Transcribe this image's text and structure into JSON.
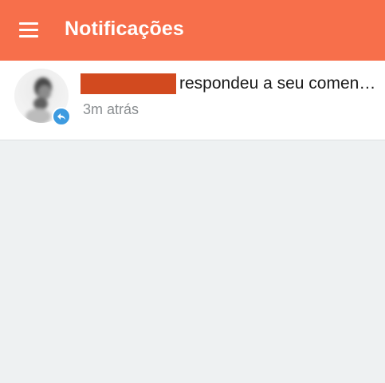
{
  "appbar": {
    "menu_icon": "hamburger-menu-icon",
    "title": "Notificações",
    "color": "#f76f4b"
  },
  "notifications": [
    {
      "sender": "",
      "message": "respondeu a seu comen…",
      "time": "3m atrás",
      "badge_icon": "reply-icon",
      "badge_color": "#3d9be0",
      "redaction_color": "#d24a1f"
    }
  ],
  "background_color": "#eef1f2"
}
